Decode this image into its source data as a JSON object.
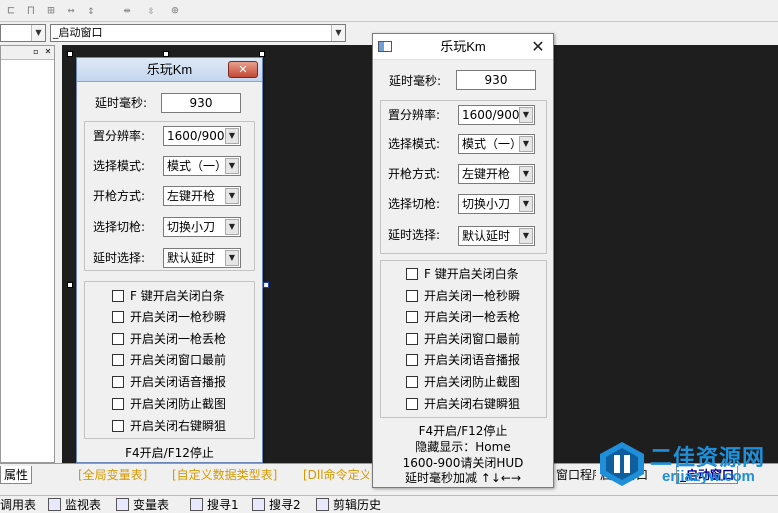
{
  "ide": {
    "combo_left": "",
    "combo_main": "_启动窗口",
    "tabs": [
      {
        "label": "属性"
      },
      {
        "label": "[全局变量表]"
      },
      {
        "label": "[自定义数据类型表]"
      },
      {
        "label": "[Dll命令定义"
      },
      {
        "label": "窗口程序"
      },
      {
        "label": "启动窗口"
      },
      {
        "label": "_启动窗口"
      }
    ],
    "status": [
      {
        "label": "调用表"
      },
      {
        "label": "监视表"
      },
      {
        "label": "变量表"
      },
      {
        "label": "搜寻1"
      },
      {
        "label": "搜寻2"
      },
      {
        "label": "剪辑历史"
      }
    ]
  },
  "dialog_a": {
    "title": "乐玩Km",
    "close_glyph": "✕",
    "delay_label": "延时毫秒:",
    "delay_value": "930",
    "fields": [
      {
        "label": "置分辨率:",
        "value": "1600/900"
      },
      {
        "label": "选择模式:",
        "value": "模式（一）"
      },
      {
        "label": "开枪方式:",
        "value": "左键开枪"
      },
      {
        "label": "选择切枪:",
        "value": "切换小刀"
      },
      {
        "label": "延时选择:",
        "value": "默认延时"
      }
    ],
    "checkboxes": [
      {
        "label": "F  键开启关闭白条"
      },
      {
        "label": "开启关闭一枪秒瞬"
      },
      {
        "label": "开启关闭一枪丢枪"
      },
      {
        "label": "开启关闭窗口最前"
      },
      {
        "label": "开启关闭语音播报"
      },
      {
        "label": "开启关闭防止截图"
      },
      {
        "label": "开启关闭右键瞬狙"
      }
    ],
    "footer": [
      "F4开启/F12停止"
    ]
  },
  "dialog_b": {
    "title": "乐玩Km",
    "close_glyph": "✕",
    "delay_label": "延时毫秒:",
    "delay_value": "930",
    "fields": [
      {
        "label": "置分辨率:",
        "value": "1600/900"
      },
      {
        "label": "选择模式:",
        "value": "模式（一）"
      },
      {
        "label": "开枪方式:",
        "value": "左键开枪"
      },
      {
        "label": "选择切枪:",
        "value": "切换小刀"
      },
      {
        "label": "延时选择:",
        "value": "默认延时"
      }
    ],
    "checkboxes": [
      {
        "label": "F  键开启关闭白条"
      },
      {
        "label": "开启关闭一枪秒瞬"
      },
      {
        "label": "开启关闭一枪丢枪"
      },
      {
        "label": "开启关闭窗口最前"
      },
      {
        "label": "开启关闭语音播报"
      },
      {
        "label": "开启关闭防止截图"
      },
      {
        "label": "开启关闭右键瞬狙"
      }
    ],
    "footer": [
      "F4开启/F12停止",
      "隐藏显示：Home",
      "1600-900请关闭HUD",
      "延时毫秒加减 ↑↓←→"
    ]
  },
  "watermark": {
    "text_cn": "二佳资源网",
    "text_en": "erjiazyw.com",
    "color": "#1f8fd9"
  }
}
